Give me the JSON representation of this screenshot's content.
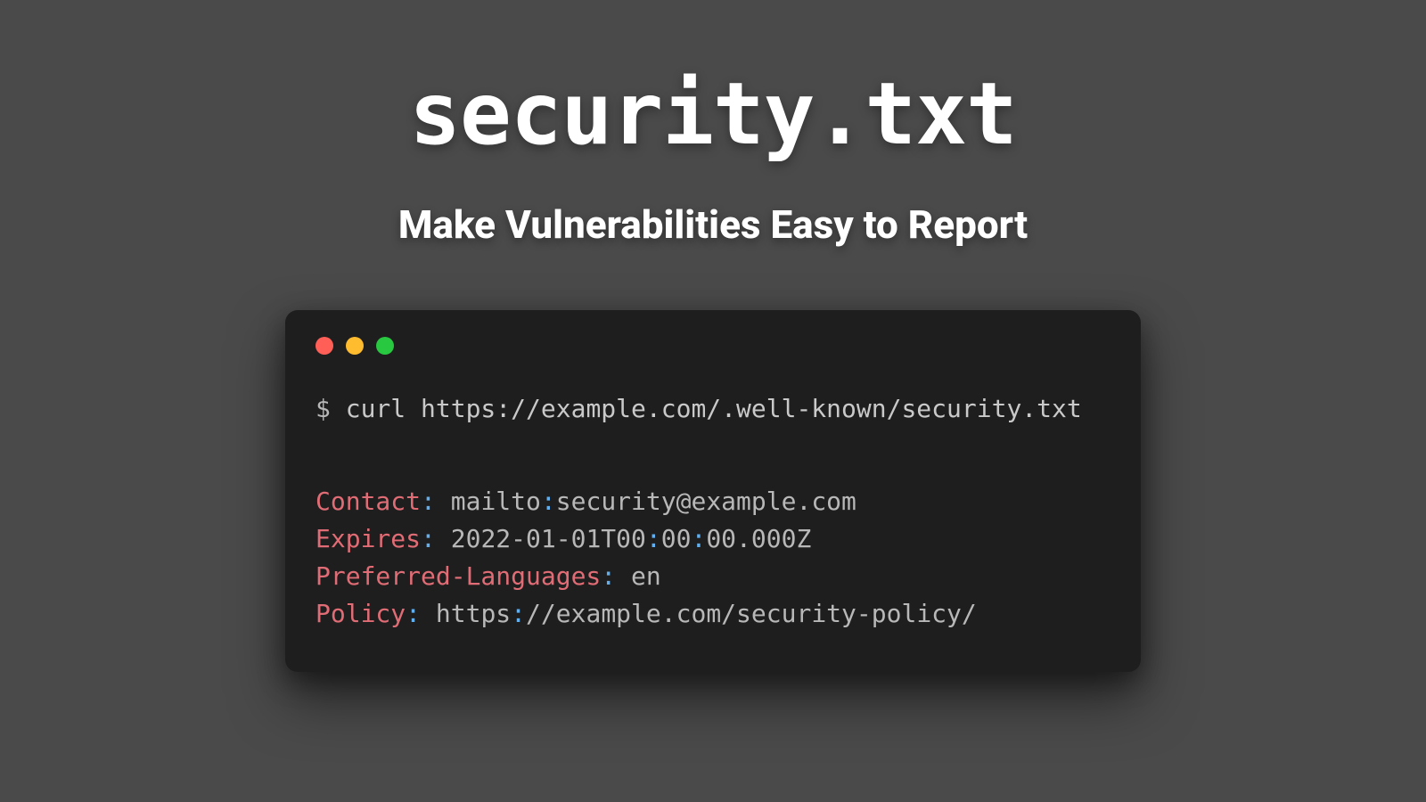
{
  "title": "security.txt",
  "subtitle": "Make Vulnerabilities Easy to Report",
  "terminal": {
    "prompt": "$ ",
    "command": "curl https://example.com/.well-known/security.txt",
    "lines": [
      {
        "key": "Contact",
        "value": " mailto:security@example.com"
      },
      {
        "key": "Expires",
        "value": " 2022-01-01T00:00:00.000Z"
      },
      {
        "key": "Preferred-Languages",
        "value": " en"
      },
      {
        "key": "Policy",
        "value": " https://example.com/security-policy/"
      }
    ]
  },
  "colors": {
    "background": "#4a4a4a",
    "terminal_bg": "#1e1e1e",
    "key": "#e06c75",
    "colon": "#61afef",
    "text": "#b8b8b8"
  }
}
